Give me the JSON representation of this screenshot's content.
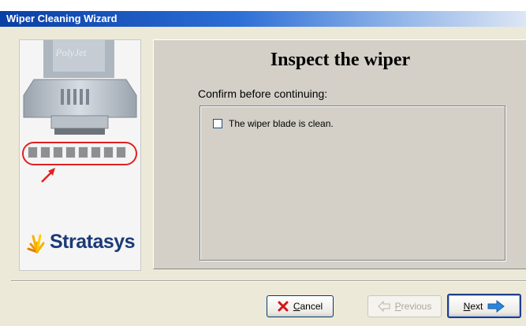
{
  "window": {
    "title": "Wiper Cleaning Wizard"
  },
  "side": {
    "head_brand": "PolyJet",
    "logo_text": "Stratasys",
    "nozzle_count": 8
  },
  "main": {
    "heading": "Inspect the wiper",
    "prompt": "Confirm before continuing:",
    "checkbox": {
      "label": "The wiper blade is clean.",
      "checked": false
    }
  },
  "buttons": {
    "cancel": {
      "label_first": "C",
      "label_rest": "ancel",
      "icon": "red-x-icon"
    },
    "previous": {
      "label_first": "P",
      "label_rest": "revious",
      "icon": "arrow-left-icon",
      "enabled": false
    },
    "next": {
      "label_first": "N",
      "label_rest": "ext",
      "icon": "arrow-right-icon",
      "default": true
    }
  },
  "colors": {
    "title_bar": "#0a3fa5",
    "highlight_circle": "#e42020",
    "logo_text": "#1b3a78",
    "next_arrow": "#2a86d8"
  }
}
